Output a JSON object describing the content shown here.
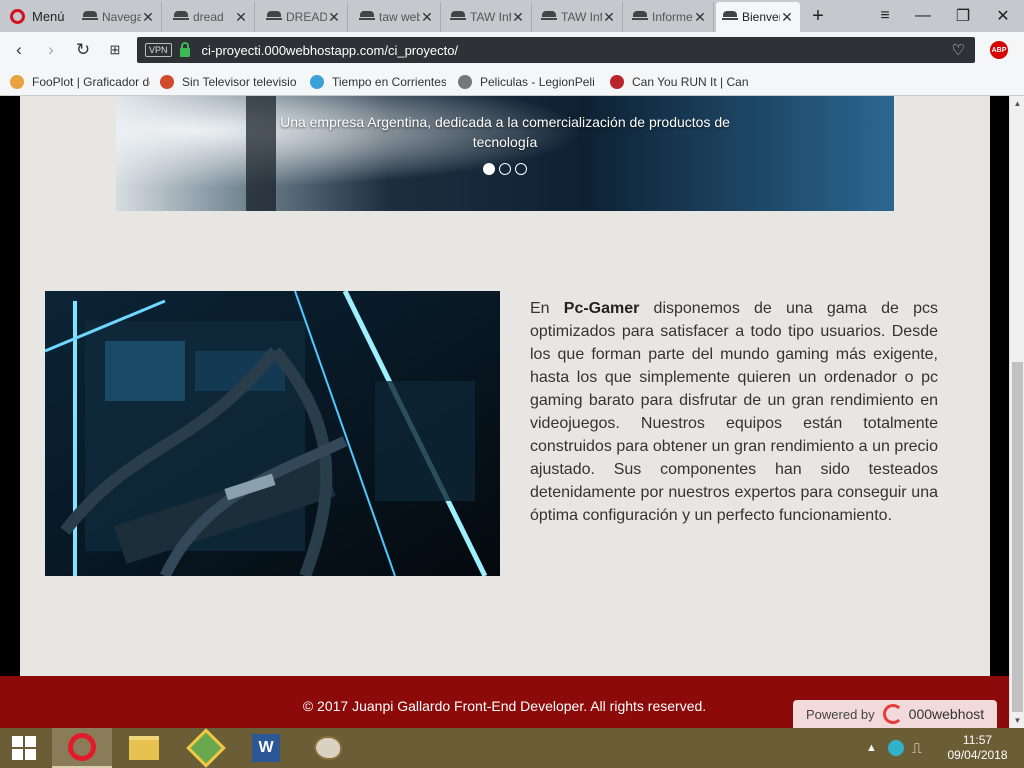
{
  "browser": {
    "menu_label": "Menú",
    "tabs": [
      {
        "title": "Navegador"
      },
      {
        "title": "dread"
      },
      {
        "title": "DREAD"
      },
      {
        "title": "taw web"
      },
      {
        "title": "TAW Inf"
      },
      {
        "title": "TAW Inf"
      },
      {
        "title": "Informe"
      },
      {
        "title": "Bienvenido",
        "active": true
      }
    ],
    "new_tab": "+",
    "url_vpn": "VPN",
    "url": "ci-proyecti.000webhostapp.com/ci_proyecto/",
    "abp_label": "ABP",
    "bookmarks": [
      {
        "label": "FooPlot | Graficador de",
        "color": "#e8a33c"
      },
      {
        "label": "Sin Televisor televisio",
        "color": "#d14a2b"
      },
      {
        "label": "Tiempo en Corrientes",
        "color": "#3ba2d8"
      },
      {
        "label": "Peliculas - LegionPeli",
        "color": "#777777"
      },
      {
        "label": "Can You RUN It | Can",
        "color": "#b8242c"
      }
    ]
  },
  "page": {
    "hero_text": "Una empresa Argentina, dedicada a la comercialización de productos de tecnología",
    "carousel_dots": 3,
    "intro_prefix": "En ",
    "brand": "Pc-Gamer",
    "intro_body": " disponemos de una gama de pcs optimizados para satisfacer a todo tipo usuarios. Desde los que forman parte del mundo gaming más exigente, hasta los que simplemente quieren un ordenador o pc gaming barato para disfrutar de un gran rendimiento en videojuegos. Nuestros equipos están totalmente construidos para obtener un gran rendimiento a un precio ajustado. Sus componentes han sido testeados detenidamente por nuestros expertos para conseguir una óptima configuración y un perfecto funcionamiento.",
    "footer_text": "© 2017 Juanpi Gallardo Front-End Developer. All rights reserved.",
    "powered_by": "Powered by",
    "powered_brand": "000webhost"
  },
  "taskbar": {
    "time": "11:57",
    "date": "09/04/2018"
  },
  "colors": {
    "footer": "#8c0a0a",
    "page_bg": "#e8e6e3",
    "taskbar": "#6b5d36"
  }
}
